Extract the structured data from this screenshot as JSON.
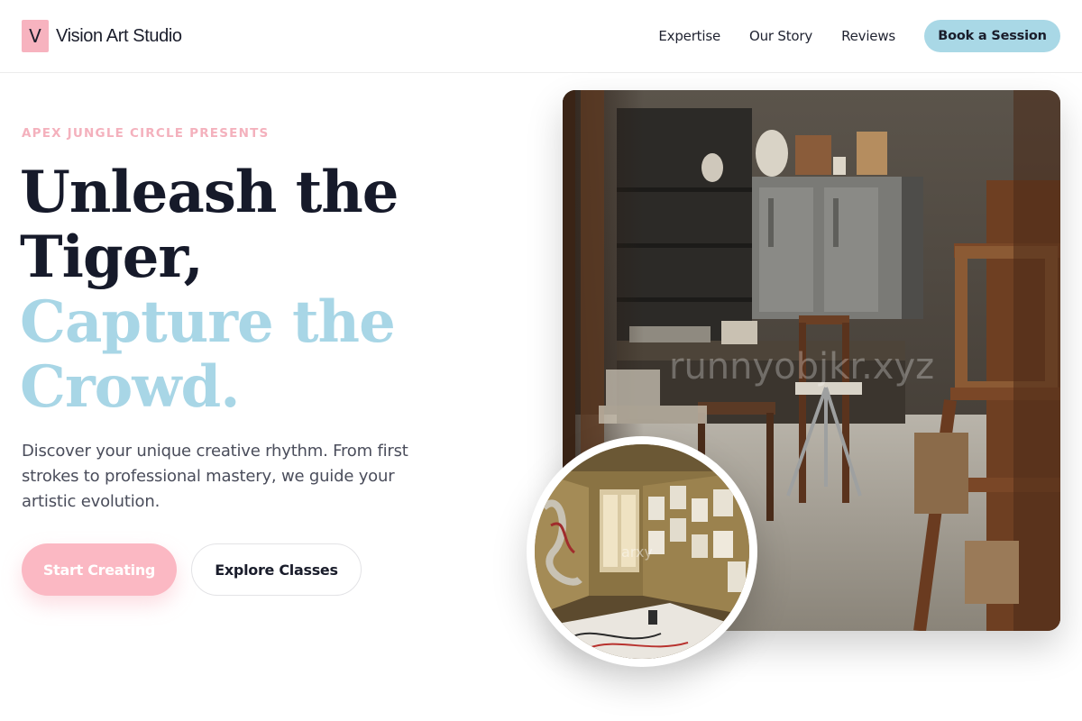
{
  "brand": {
    "mark": "V",
    "name": "Vision Art Studio"
  },
  "nav": {
    "links": [
      "Expertise",
      "Our Story",
      "Reviews"
    ],
    "cta": "Book a Session"
  },
  "hero": {
    "eyebrow": "APEX JUNGLE CIRCLE PRESENTS",
    "headline_dark": [
      "Unleash the",
      "Tiger,"
    ],
    "headline_light": [
      "Capture the",
      "Crowd."
    ],
    "lede": "Discover your unique creative rhythm. From first strokes to professional mastery, we guide your artistic evolution.",
    "primary_button": "Start Creating",
    "secondary_button": "Explore Classes"
  },
  "media": {
    "main_image_watermark": "runnyobjkr.xyz",
    "inset_image_watermark": "arxy"
  },
  "colors": {
    "accent_pink": "#f7b3bf",
    "accent_blue": "#a9d8e6",
    "text_dark": "#161a2a",
    "text_muted": "#4a4d5b"
  }
}
